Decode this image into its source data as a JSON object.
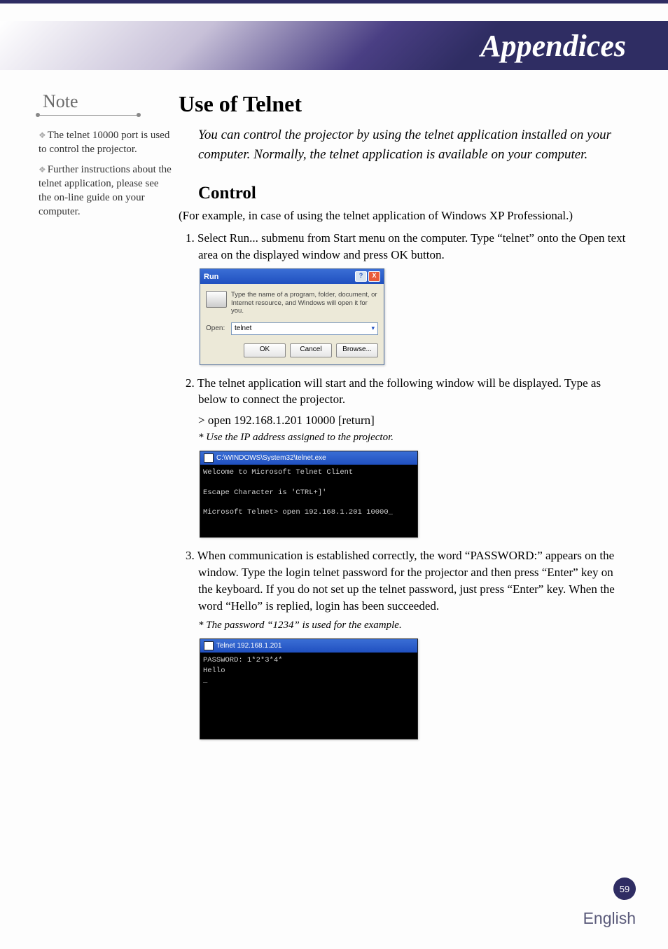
{
  "header": {
    "title": "Appendices"
  },
  "sidebar": {
    "note_label": "Note",
    "notes": [
      "The telnet 10000 port is used to control the projector.",
      "Further instructions about the telnet application, please see the on-line guide on your computer."
    ]
  },
  "main": {
    "h1": "Use of Telnet",
    "intro": "You can control the projector by using the telnet application installed on your computer. Normally, the telnet application is available on your computer.",
    "h2": "Control",
    "paren": "(For example, in case of using the telnet application of Windows XP Professional.)",
    "step1": "1. Select Run... submenu from Start menu on the computer. Type “telnet” onto the Open text area on the displayed window and press OK button.",
    "step2": "2. The telnet application will start and the following window will be displayed. Type as below to connect the projector.",
    "cmd": "> open 192.168.1.201 10000 [return]",
    "cmd_note": "* Use the IP address assigned to the projector.",
    "step3": "3. When communication is established correctly, the word “PASSWORD:” appears on the window. Type the login telnet password for the projector and then press “Enter” key on the keyboard. If you do not set up the telnet password, just press “Enter” key. When the word “Hello” is replied, login has been succeeded.",
    "pw_note": "* The password “1234” is used for the example."
  },
  "run_dialog": {
    "title": "Run",
    "help_btn": "?",
    "close_btn": "X",
    "desc": "Type the name of a program, folder, document, or Internet resource, and Windows will open it for you.",
    "open_label": "Open:",
    "input_value": "telnet",
    "ok": "OK",
    "cancel": "Cancel",
    "browse": "Browse..."
  },
  "console1": {
    "title": "C:\\WINDOWS\\System32\\telnet.exe",
    "body": "Welcome to Microsoft Telnet Client\n\nEscape Character is 'CTRL+]'\n\nMicrosoft Telnet> open 192.168.1.201 10000_"
  },
  "console2": {
    "title": "Telnet 192.168.1.201",
    "body": "PASSWORD: 1*2*3*4*\nHello\n_"
  },
  "footer": {
    "page": "59",
    "lang": "English"
  }
}
